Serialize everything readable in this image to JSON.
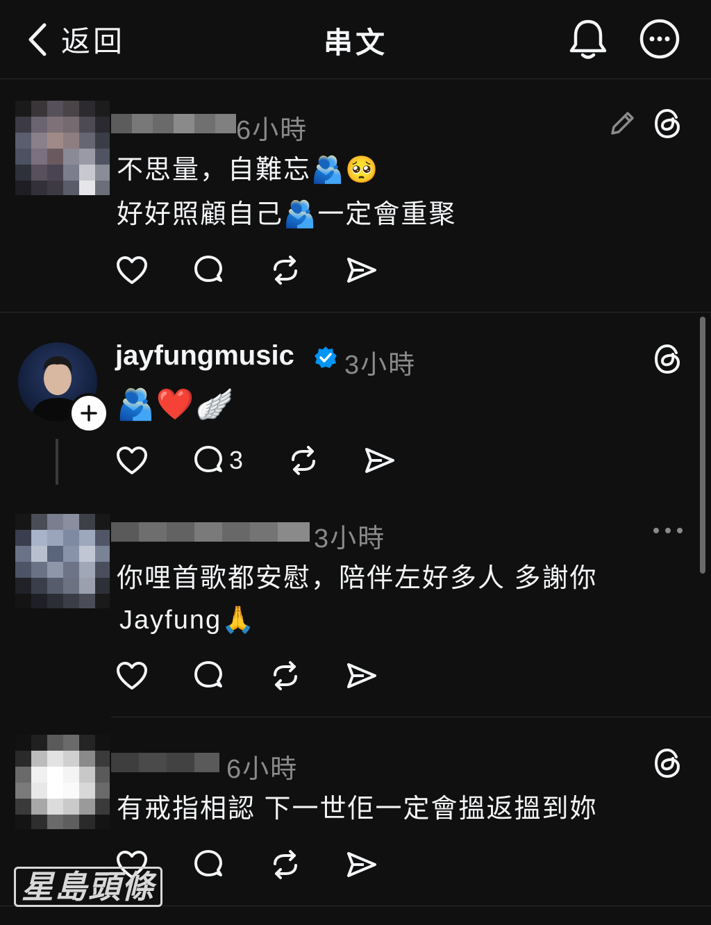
{
  "header": {
    "back_label": "返回",
    "title": "串文"
  },
  "posts": [
    {
      "time": "6小時",
      "lines": [
        "不思量，自難忘🫂🥺",
        "好好照顧自己🫂一定會重聚"
      ]
    },
    {
      "username": "jayfungmusic",
      "time": "3小時",
      "lines": [
        "🫂❤️🪽"
      ],
      "reply_count": "3"
    },
    {
      "time": "3小時",
      "lines": [
        "你哩首歌都安慰，陪伴左好多人 多謝你",
        "Jayfung🙏"
      ]
    },
    {
      "time": "6小時",
      "lines": [
        "有戒指相認 下一世佢一定會搵返搵到妳"
      ]
    }
  ],
  "watermark": "星島頭條",
  "colors": {
    "background": "#101010",
    "text": "#f3f5f7",
    "muted": "#8a8a8a",
    "verified": "#0095f6",
    "divider": "#2a2a2a"
  },
  "icons": [
    "chevron-left-icon",
    "bell-icon",
    "more-circle-icon",
    "pencil-icon",
    "threads-icon",
    "heart-icon",
    "comment-icon",
    "repost-icon",
    "share-icon",
    "verified-badge-icon",
    "plus-icon",
    "more-horizontal-icon"
  ]
}
